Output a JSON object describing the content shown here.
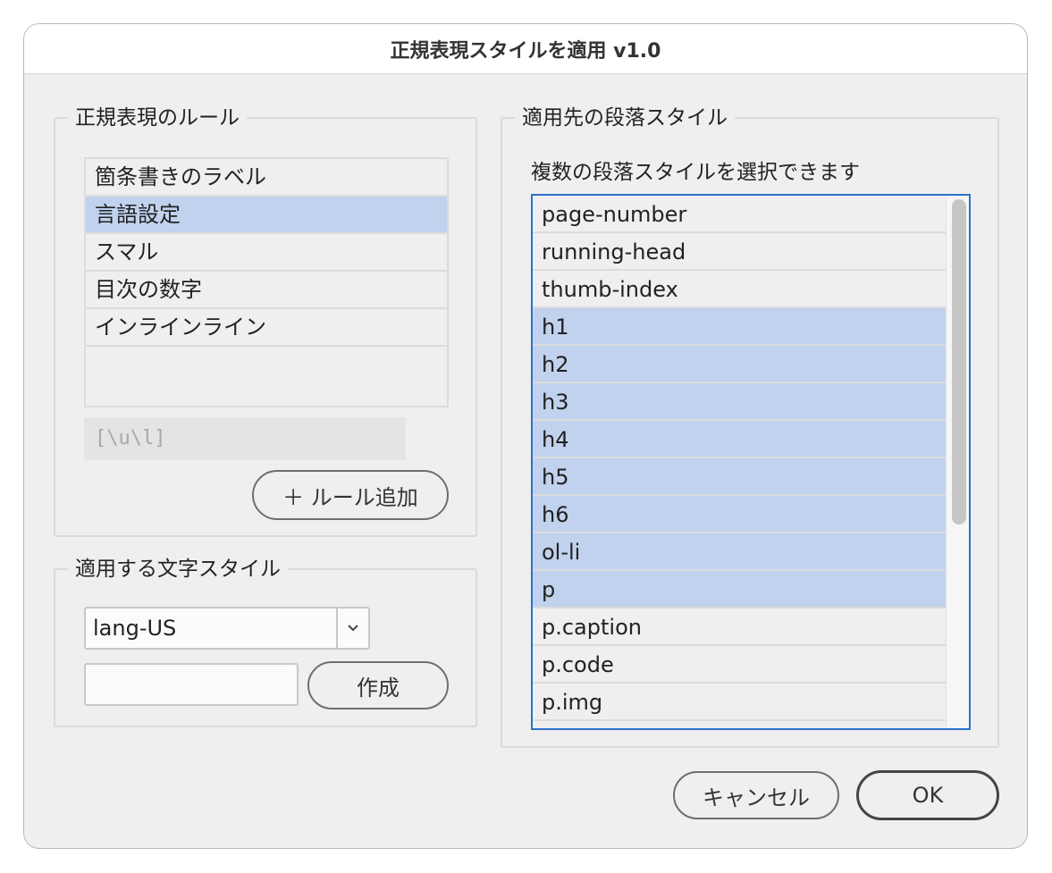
{
  "dialog": {
    "title": "正規表現スタイルを適用 v1.0"
  },
  "rules": {
    "group_title": "正規表現のルール",
    "items": [
      "箇条書きのラベル",
      "言語設定",
      "スマル",
      "目次の数字",
      "インラインライン"
    ],
    "selected_index": 1,
    "regex_value": "[\\u\\l]",
    "add_button": "＋ ルール追加"
  },
  "char_style": {
    "group_title": "適用する文字スタイル",
    "selected": "lang-US",
    "create_button": "作成"
  },
  "para_styles": {
    "group_title": "適用先の段落スタイル",
    "hint": "複数の段落スタイルを選択できます",
    "items": [
      "page-number",
      "running-head",
      "thumb-index",
      "h1",
      "h2",
      "h3",
      "h4",
      "h5",
      "h6",
      "ol-li",
      "p",
      "p.caption",
      "p.code",
      "p.img"
    ],
    "selected": [
      "h1",
      "h2",
      "h3",
      "h4",
      "h5",
      "h6",
      "ol-li",
      "p"
    ]
  },
  "buttons": {
    "cancel": "キャンセル",
    "ok": "OK"
  },
  "colors": {
    "selection": "#c1d2ee",
    "focus_border": "#2a72c9"
  },
  "icons": {
    "select_arrow": "chevron-down-icon"
  }
}
